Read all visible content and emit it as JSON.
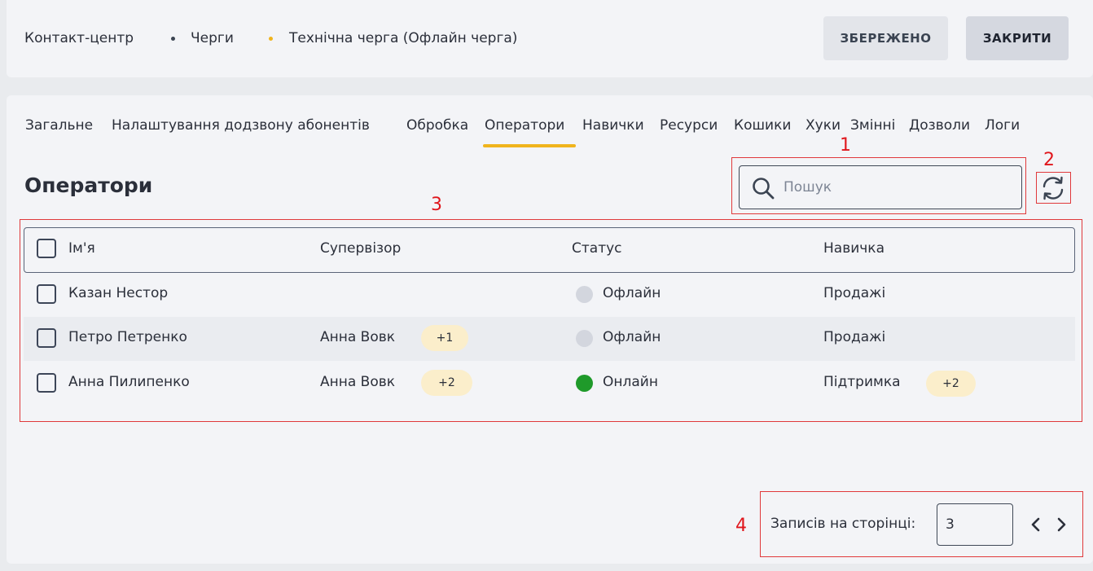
{
  "breadcrumb": {
    "items": [
      "Контакт-центр",
      "Черги",
      "Технічна черга (Офлайн черга)"
    ],
    "dot_colors": [
      "#3b4452",
      "#f0b41c"
    ]
  },
  "toolbar": {
    "saved_label": "ЗБЕРЕЖЕНО",
    "close_label": "ЗАКРИТИ"
  },
  "tabs": [
    {
      "label": "Загальне"
    },
    {
      "label": "Налаштування додзвону абонентів"
    },
    {
      "label": "Обробка"
    },
    {
      "label": "Оператори",
      "active": true
    },
    {
      "label": "Навички"
    },
    {
      "label": "Ресурси"
    },
    {
      "label": "Кошики"
    },
    {
      "label": "Хуки"
    },
    {
      "label": "Змінні"
    },
    {
      "label": "Дозволи"
    },
    {
      "label": "Логи"
    }
  ],
  "section": {
    "title": "Оператори"
  },
  "search": {
    "placeholder": "Пошук",
    "icon": "search-icon"
  },
  "refresh": {
    "icon": "refresh-icon"
  },
  "table": {
    "columns": [
      "Ім'я",
      "Супервізор",
      "Статус",
      "Навичка"
    ],
    "rows": [
      {
        "name": "Казан Нестор",
        "supervisor": "",
        "supervisor_extra": "",
        "status": "Офлайн",
        "status_color": "#d3d6de",
        "skill": "Продажі",
        "skill_extra": ""
      },
      {
        "name": "Петро Петренко",
        "supervisor": "Анна Вовк",
        "supervisor_extra": "+1",
        "status": "Офлайн",
        "status_color": "#d3d6de",
        "skill": "Продажі",
        "skill_extra": ""
      },
      {
        "name": "Анна Пилипенко",
        "supervisor": "Анна Вовк",
        "supervisor_extra": "+2",
        "status": "Онлайн",
        "status_color": "#1f9a2a",
        "skill": "Підтримка",
        "skill_extra": "+2"
      }
    ]
  },
  "pagination": {
    "label": "Записів на сторінці:",
    "per_page": "3"
  },
  "annotations": [
    "1",
    "2",
    "3",
    "4"
  ],
  "colors": {
    "accent": "#f0b41c",
    "annotation": "#e0161c",
    "online": "#1f9a2a",
    "offline": "#d3d6de",
    "pill": "#fbeecb"
  }
}
